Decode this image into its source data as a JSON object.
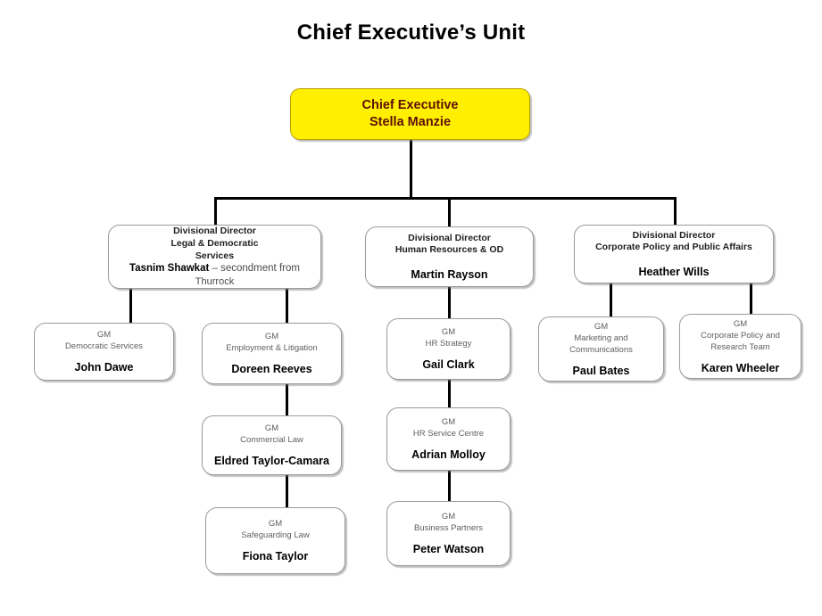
{
  "page": {
    "title": "Chief Executive’s Unit"
  },
  "colors": {
    "root_fill": "#ffef00",
    "root_text": "#5e1008",
    "node_fill": "#ffffff",
    "node_border": "#9a9a9a",
    "role_text": "#5f5f5f",
    "name_text": "#000000",
    "connector": "#000000"
  },
  "root_node": {
    "title_line": "Chief Executive",
    "person": "Stella Manzie"
  },
  "directors": [
    {
      "role_lines": "Divisional Director\nLegal & Democratic\nServices",
      "person_bold": "Tasnim Shawkat",
      "person_rest": " – secondment from",
      "person_trailing": "Thurrock"
    },
    {
      "role_lines": "Divisional Director\nHuman Resources & OD",
      "person": "Martin Rayson"
    },
    {
      "role_lines": "Divisional Director\nCorporate Policy and Public Affairs",
      "person": "Heather Wills"
    }
  ],
  "managers": {
    "democratic_services": {
      "role_lines": "GM\nDemocratic Services",
      "person": "John Dawe"
    },
    "employment_litigation": {
      "role_lines": "GM\nEmployment & Litigation",
      "person": "Doreen Reeves"
    },
    "commercial_law": {
      "role_lines": "GM\nCommercial Law",
      "person": "Eldred Taylor-Camara"
    },
    "safeguarding_law": {
      "role_lines": "GM\nSafeguarding Law",
      "person": "Fiona Taylor"
    },
    "hr_strategy": {
      "role_lines": "GM\nHR Strategy",
      "person": "Gail Clark"
    },
    "hr_service_centre": {
      "role_lines": "GM\nHR Service Centre",
      "person": "Adrian Molloy"
    },
    "business_partners": {
      "role_lines": "GM\nBusiness Partners",
      "person": "Peter Watson"
    },
    "marketing_communications": {
      "role_lines": "GM\nMarketing and\nCommunications",
      "person": "Paul Bates"
    },
    "corporate_policy_research": {
      "role_lines": "GM\nCorporate Policy and\nResearch Team",
      "person": "Karen Wheeler"
    }
  },
  "chart_data": {
    "type": "diagram",
    "diagram_kind": "organizational-chart",
    "title": "Chief Executive’s Unit",
    "nodes": [
      {
        "id": "ceo",
        "label": "Chief Executive",
        "person": "Stella Manzie",
        "level": 0,
        "highlight": true
      },
      {
        "id": "dd-legal",
        "label": "Divisional Director Legal & Democratic Services",
        "person": "Tasnim Shawkat – secondment from Thurrock",
        "level": 1
      },
      {
        "id": "dd-hr",
        "label": "Divisional Director Human Resources & OD",
        "person": "Martin Rayson",
        "level": 1
      },
      {
        "id": "dd-corp",
        "label": "Divisional Director Corporate Policy and Public Affairs",
        "person": "Heather Wills",
        "level": 1
      },
      {
        "id": "gm-democratic",
        "label": "GM Democratic Services",
        "person": "John Dawe",
        "level": 2
      },
      {
        "id": "gm-employment",
        "label": "GM Employment & Litigation",
        "person": "Doreen Reeves",
        "level": 2
      },
      {
        "id": "gm-commercial",
        "label": "GM Commercial Law",
        "person": "Eldred Taylor-Camara",
        "level": 3
      },
      {
        "id": "gm-safeguarding",
        "label": "GM Safeguarding Law",
        "person": "Fiona Taylor",
        "level": 4
      },
      {
        "id": "gm-hr-strategy",
        "label": "GM HR Strategy",
        "person": "Gail Clark",
        "level": 2
      },
      {
        "id": "gm-hr-service",
        "label": "GM HR Service Centre",
        "person": "Adrian Molloy",
        "level": 3
      },
      {
        "id": "gm-business-partners",
        "label": "GM Business Partners",
        "person": "Peter Watson",
        "level": 4
      },
      {
        "id": "gm-marketing",
        "label": "GM Marketing and Communications",
        "person": "Paul Bates",
        "level": 2
      },
      {
        "id": "gm-corp-research",
        "label": "GM Corporate Policy and Research Team",
        "person": "Karen Wheeler",
        "level": 2
      }
    ],
    "edges": [
      {
        "from": "ceo",
        "to": "dd-legal"
      },
      {
        "from": "ceo",
        "to": "dd-hr"
      },
      {
        "from": "ceo",
        "to": "dd-corp"
      },
      {
        "from": "dd-legal",
        "to": "gm-democratic"
      },
      {
        "from": "dd-legal",
        "to": "gm-employment"
      },
      {
        "from": "gm-employment",
        "to": "gm-commercial"
      },
      {
        "from": "gm-commercial",
        "to": "gm-safeguarding"
      },
      {
        "from": "dd-hr",
        "to": "gm-hr-strategy"
      },
      {
        "from": "gm-hr-strategy",
        "to": "gm-hr-service"
      },
      {
        "from": "gm-hr-service",
        "to": "gm-business-partners"
      },
      {
        "from": "dd-corp",
        "to": "gm-marketing"
      },
      {
        "from": "dd-corp",
        "to": "gm-corp-research"
      }
    ]
  }
}
